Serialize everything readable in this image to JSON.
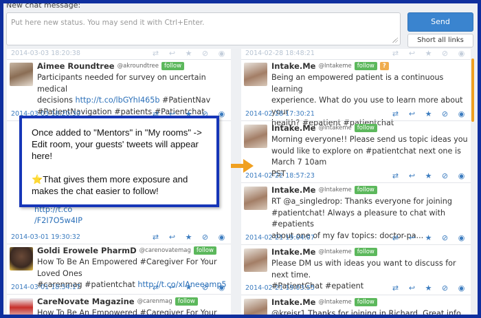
{
  "composer": {
    "label": "New chat message:",
    "placeholder": "Put here new status. You may send it with Ctrl+Enter.",
    "send_label": "Send",
    "short_links_label": "Short all links"
  },
  "left_column": {
    "top_timestamp": "2014-03-03 18:20:38",
    "tweets": [
      {
        "name": "Aimee Roundtree",
        "handle": "@akroundtree",
        "follow": "follow",
        "text_lines": [
          "Participants needed for survey on uncertain medical",
          "decisions ",
          "#PatientNavigation #patients #Patientchat"
        ],
        "link": "http://t.co/lbGYhI465b",
        "link_tail": " #PatientNav",
        "timestamp": "2014-03-03 18:20:30"
      },
      {
        "partial_lines": [
          "our Loved Ones #carenmag #patientchat http://t.co",
          "/F2I7O5w4IP"
        ],
        "timestamp": "2014-03-01 19:30:32"
      },
      {
        "name": "Goldi Erowele PharmD",
        "handle": "@carenovatemag",
        "follow": "follow",
        "text_line1": "How To Be An Empowered #Caregiver For Your Loved Ones",
        "text_line2_pre": "#carenmag #patientchat ",
        "link": "http://t.co/xlAneeamp5",
        "timestamp": "2014-03-01 18:54:17"
      },
      {
        "name": "CareNovate Magazine",
        "handle": "@carenmag",
        "follow": "follow",
        "text_line1": "How To Be An Empowered #Caregiver For Your Loved Ones"
      }
    ]
  },
  "right_column": {
    "top_timestamp": "2014-02-28 18:48:21",
    "tweets": [
      {
        "name": "Intake.Me",
        "handle": "@Intakeme",
        "follow": "follow",
        "badge": "?",
        "text_lines": [
          "Being an empowered patient is a continuous learning",
          "experience. What do you use to learn more about your",
          "health? #epatient #patientchat"
        ],
        "timestamp": "2014-02-28 17:30:21"
      },
      {
        "name": "Intake.Me",
        "handle": "@Intakeme",
        "follow": "follow",
        "text_lines": [
          "Morning everyone!! Please send us topic ideas you",
          "would like to explore on #patientchat next one is March 7 10am",
          "PST"
        ],
        "timestamp": "2014-02-22 18:57:23"
      },
      {
        "name": "Intake.Me",
        "handle": "@Intakeme",
        "follow": "follow",
        "text_lines": [
          "RT @a_singledrop: Thanks everyone for joining",
          "#patientchat! Always a pleasure to chat with #epatients",
          "about one of my fav topics: doctor-pa..."
        ],
        "timestamp": "2014-02-21 19:04:07"
      },
      {
        "name": "Intake.Me",
        "handle": "@Intakeme",
        "follow": "follow",
        "text_lines": [
          "Please DM us with ideas you want to discuss for next time.",
          "#PatientChat #epatient"
        ],
        "timestamp": "2014-02-21 19:03:55"
      },
      {
        "name": "Intake.Me",
        "handle": "@Intakeme",
        "follow": "follow",
        "text_lines": [
          "@kreisr1 Thanks for joining in Richard. Great info you"
        ]
      }
    ]
  },
  "callout": {
    "line1": "Once added to \"Mentors\" in \"My rooms\" -> Edit room, your guests' tweets will appear here!",
    "star": "⭐",
    "line2": "That gives them more exposure and makes the chat easier to follow!"
  },
  "icons": {
    "retweet": "retweet-icon",
    "reply": "reply-icon",
    "favorite": "star-icon",
    "block": "block-icon",
    "view": "eye-icon"
  },
  "colors": {
    "frame": "#0f2f9e",
    "accent": "#3a84cf",
    "follow": "#5cb85c",
    "arrow": "#f0a020"
  }
}
